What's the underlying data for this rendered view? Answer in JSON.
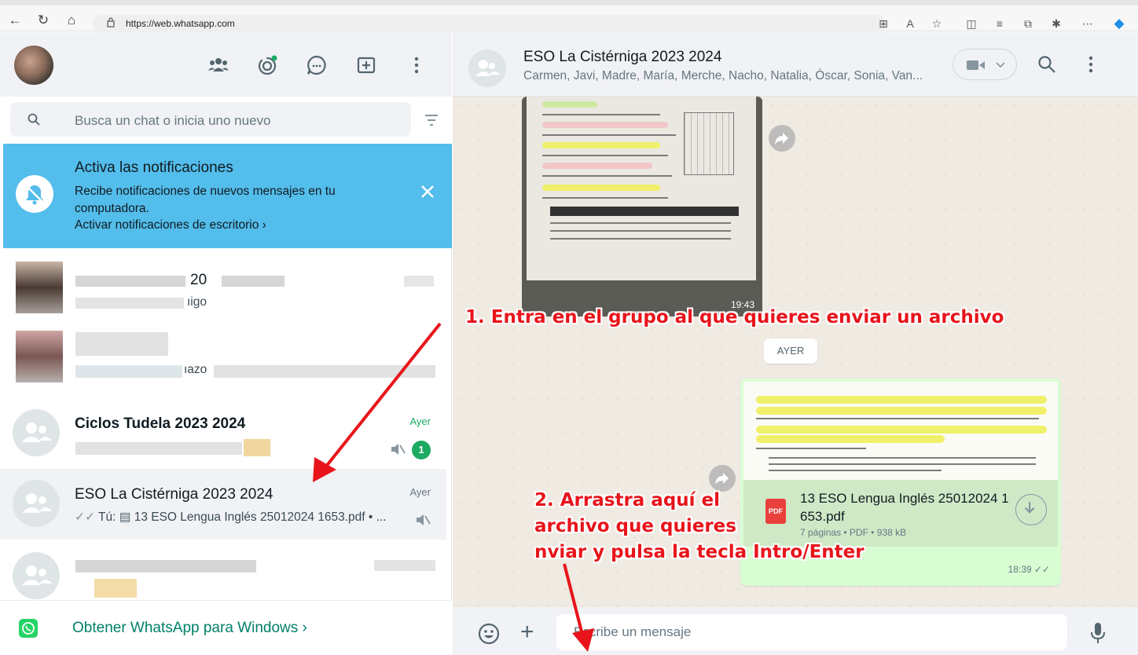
{
  "browser": {
    "url": "https://web.whatsapp.com"
  },
  "sidebar": {
    "search_placeholder": "Busca un chat o inicia uno nuevo",
    "notification": {
      "title": "Activa las notificaciones",
      "body": "Recibe notificaciones de nuevos mensajes en tu computadora.",
      "action": "Activar notificaciones de escritorio ›"
    },
    "chats": [
      {
        "name_fragment": "20",
        "preview_fragment": "ıigo"
      },
      {
        "preview_fragment": "ıazo"
      },
      {
        "name": "Ciclos Tudela 2023 2024",
        "time": "Ayer",
        "unread": "1"
      },
      {
        "name": "ESO La Cistérniga 2023 2024",
        "time": "Ayer",
        "preview_prefix": "Tú:",
        "preview": "13 ESO Lengua Inglés 25012024 1653.pdf • ..."
      }
    ],
    "get_app_label": "Obtener WhatsApp para Windows ›"
  },
  "chat": {
    "group_name": "ESO La Cistérniga 2023 2024",
    "members": "Carmen, Javi, Madre, María, Merche, Nacho, Natalia, Óscar, Sonia, Van...",
    "image_time": "19:43",
    "day_separator": "AYER",
    "document": {
      "file_name": "13 ESO Lengua Inglés 25012024 1 653.pdf",
      "meta": "7 páginas • PDF • 938 kB",
      "icon_label": "PDF",
      "time": "18:39 ✓✓"
    },
    "composer_placeholder": "Escribe un mensaje"
  },
  "annotations": {
    "step1": "1. Entra en el grupo al que quieres enviar un archivo",
    "step2_line1": "2. Arrastra aquí el",
    "step2_line2": "archivo que quieres",
    "step2_line3": "nviar y pulsa la tecla Intro/Enter"
  },
  "colors": {
    "accent": "#008069",
    "notification_bg": "#53bdeb",
    "annotation": "#e8141b",
    "outgoing_bubble": "#d9fdd3"
  }
}
